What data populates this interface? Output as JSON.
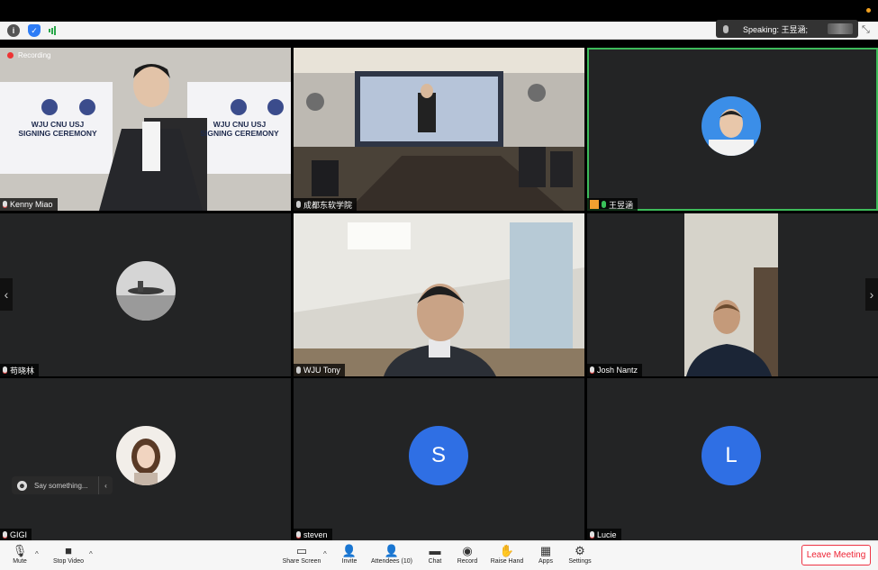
{
  "speaking": {
    "label": "Speaking: 王昱涵;"
  },
  "recording": {
    "label": "Recording"
  },
  "tiles": [
    {
      "name": "Kenny Miao"
    },
    {
      "name": "成都东软学院"
    },
    {
      "name": "王昱涵"
    },
    {
      "name": "苟晓林"
    },
    {
      "name": "WJU Tony"
    },
    {
      "name": "Josh Nantz"
    },
    {
      "name": "GIGI"
    },
    {
      "name": "steven",
      "letter": "S"
    },
    {
      "name": "Lucie",
      "letter": "L"
    }
  ],
  "slide": {
    "line1": "WJU CNU USJ",
    "line2": "SIGNING CEREMONY"
  },
  "chat": {
    "placeholder": "Say something..."
  },
  "toolbar": {
    "mute": "Mute",
    "stop_video": "Stop Video",
    "share_screen": "Share Screen",
    "invite": "Invite",
    "attendees": "Attendees (10)",
    "chat": "Chat",
    "record": "Record",
    "raise_hand": "Raise Hand",
    "apps": "Apps",
    "settings": "Settings",
    "leave": "Leave Meeting"
  },
  "colors": {
    "active_border": "#3dbb5a",
    "avatar_blue": "#2f6fe4",
    "leave_red": "#e23"
  }
}
